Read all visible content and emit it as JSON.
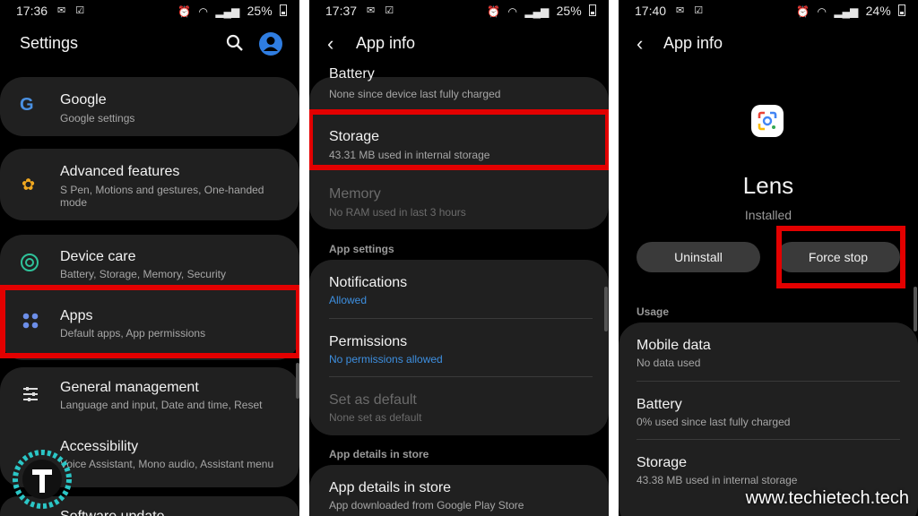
{
  "panel1": {
    "status": {
      "time": "17:36",
      "battery": "25%"
    },
    "title": "Settings",
    "items": [
      {
        "title": "Google",
        "sub": "Google settings"
      },
      {
        "title": "Advanced features",
        "sub1": "S Pen, Motions and gestures, One-handed",
        "sub2": "mode"
      },
      {
        "title": "Device care",
        "sub": "Battery, Storage, Memory, Security"
      },
      {
        "title": "Apps",
        "sub": "Default apps, App permissions"
      },
      {
        "title": "General management",
        "sub": "Language and input, Date and time, Reset"
      },
      {
        "title": "Accessibility",
        "sub": "Voice Assistant, Mono audio, Assistant menu"
      },
      {
        "title": "Software update"
      }
    ]
  },
  "panel2": {
    "status": {
      "time": "17:37",
      "battery": "25%"
    },
    "title": "App info",
    "battery": {
      "title": "Battery",
      "sub": "None since device last fully charged"
    },
    "storage": {
      "title": "Storage",
      "sub": "43.31 MB used in internal storage"
    },
    "memory": {
      "title": "Memory",
      "sub": "No RAM used in last 3 hours"
    },
    "section_app_settings": "App settings",
    "notifications": {
      "title": "Notifications",
      "sub": "Allowed"
    },
    "permissions": {
      "title": "Permissions",
      "sub": "No permissions allowed"
    },
    "default": {
      "title": "Set as default",
      "sub": "None set as default"
    },
    "section_store": "App details in store",
    "store": {
      "title": "App details in store",
      "sub": "App downloaded from Google Play Store"
    }
  },
  "panel3": {
    "status": {
      "time": "17:40",
      "battery": "24%"
    },
    "title": "App info",
    "app_name": "Lens",
    "app_state": "Installed",
    "uninstall": "Uninstall",
    "force_stop": "Force stop",
    "section_usage": "Usage",
    "mobile_data": {
      "title": "Mobile data",
      "sub": "No data used"
    },
    "battery": {
      "title": "Battery",
      "sub": "0% used since last fully charged"
    },
    "storage": {
      "title": "Storage",
      "sub": "43.38 MB used in internal storage"
    }
  },
  "watermark": "www.techietech.tech",
  "colors": {
    "highlight": "#e30000",
    "accent_blue": "#3d8fe0",
    "card": "#202020"
  }
}
